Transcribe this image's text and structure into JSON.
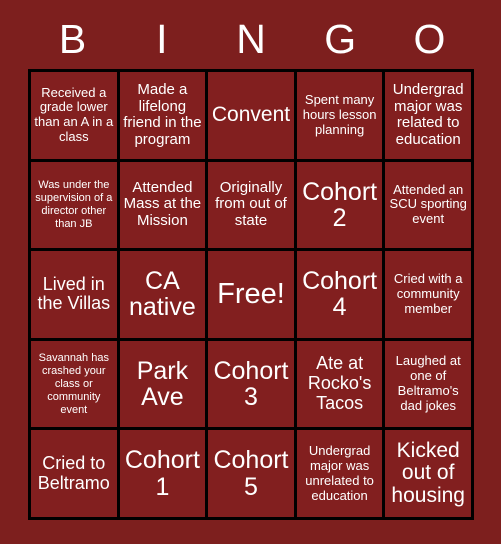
{
  "header": {
    "letters": [
      "B",
      "I",
      "N",
      "G",
      "O"
    ]
  },
  "colors": {
    "background": "#7d1f1e",
    "cell": "#821f1f",
    "gridline": "#000000",
    "text": "#ffffff"
  },
  "grid": {
    "rows": 5,
    "columns": 5,
    "cells": [
      {
        "text": "Received a grade lower than an A in a class",
        "size": "fs-s",
        "free": false
      },
      {
        "text": "Made a lifelong friend in the program",
        "size": "fs-m",
        "free": false
      },
      {
        "text": "Convent",
        "size": "fs-xl",
        "free": false
      },
      {
        "text": "Spent many hours lesson planning",
        "size": "fs-s",
        "free": false
      },
      {
        "text": "Undergrad major was related to education",
        "size": "fs-m",
        "free": false
      },
      {
        "text": "Was under the supervision of a director other than JB",
        "size": "fs-xs",
        "free": false
      },
      {
        "text": "Attended Mass at the Mission",
        "size": "fs-m",
        "free": false
      },
      {
        "text": "Originally from out of state",
        "size": "fs-m",
        "free": false
      },
      {
        "text": "Cohort 2",
        "size": "fs-xxl",
        "free": false
      },
      {
        "text": "Attended an SCU sporting event",
        "size": "fs-s",
        "free": false
      },
      {
        "text": "Lived in the Villas",
        "size": "fs-l",
        "free": false
      },
      {
        "text": "CA native",
        "size": "fs-xxl",
        "free": false
      },
      {
        "text": "Free!",
        "size": "fs-free",
        "free": true
      },
      {
        "text": "Cohort 4",
        "size": "fs-xxl",
        "free": false
      },
      {
        "text": "Cried with a community member",
        "size": "fs-s",
        "free": false
      },
      {
        "text": "Savannah has crashed your class or community event",
        "size": "fs-xs",
        "free": false
      },
      {
        "text": "Park Ave",
        "size": "fs-xxl",
        "free": false
      },
      {
        "text": "Cohort 3",
        "size": "fs-xxl",
        "free": false
      },
      {
        "text": "Ate at Rocko's Tacos",
        "size": "fs-l",
        "free": false
      },
      {
        "text": "Laughed at one of Beltramo's dad jokes",
        "size": "fs-s",
        "free": false
      },
      {
        "text": "Cried to Beltramo",
        "size": "fs-l",
        "free": false
      },
      {
        "text": "Cohort 1",
        "size": "fs-xxl",
        "free": false
      },
      {
        "text": "Cohort 5",
        "size": "fs-xxl",
        "free": false
      },
      {
        "text": "Undergrad major was unrelated to education",
        "size": "fs-s",
        "free": false
      },
      {
        "text": "Kicked out of housing",
        "size": "fs-xl",
        "free": false
      }
    ]
  }
}
